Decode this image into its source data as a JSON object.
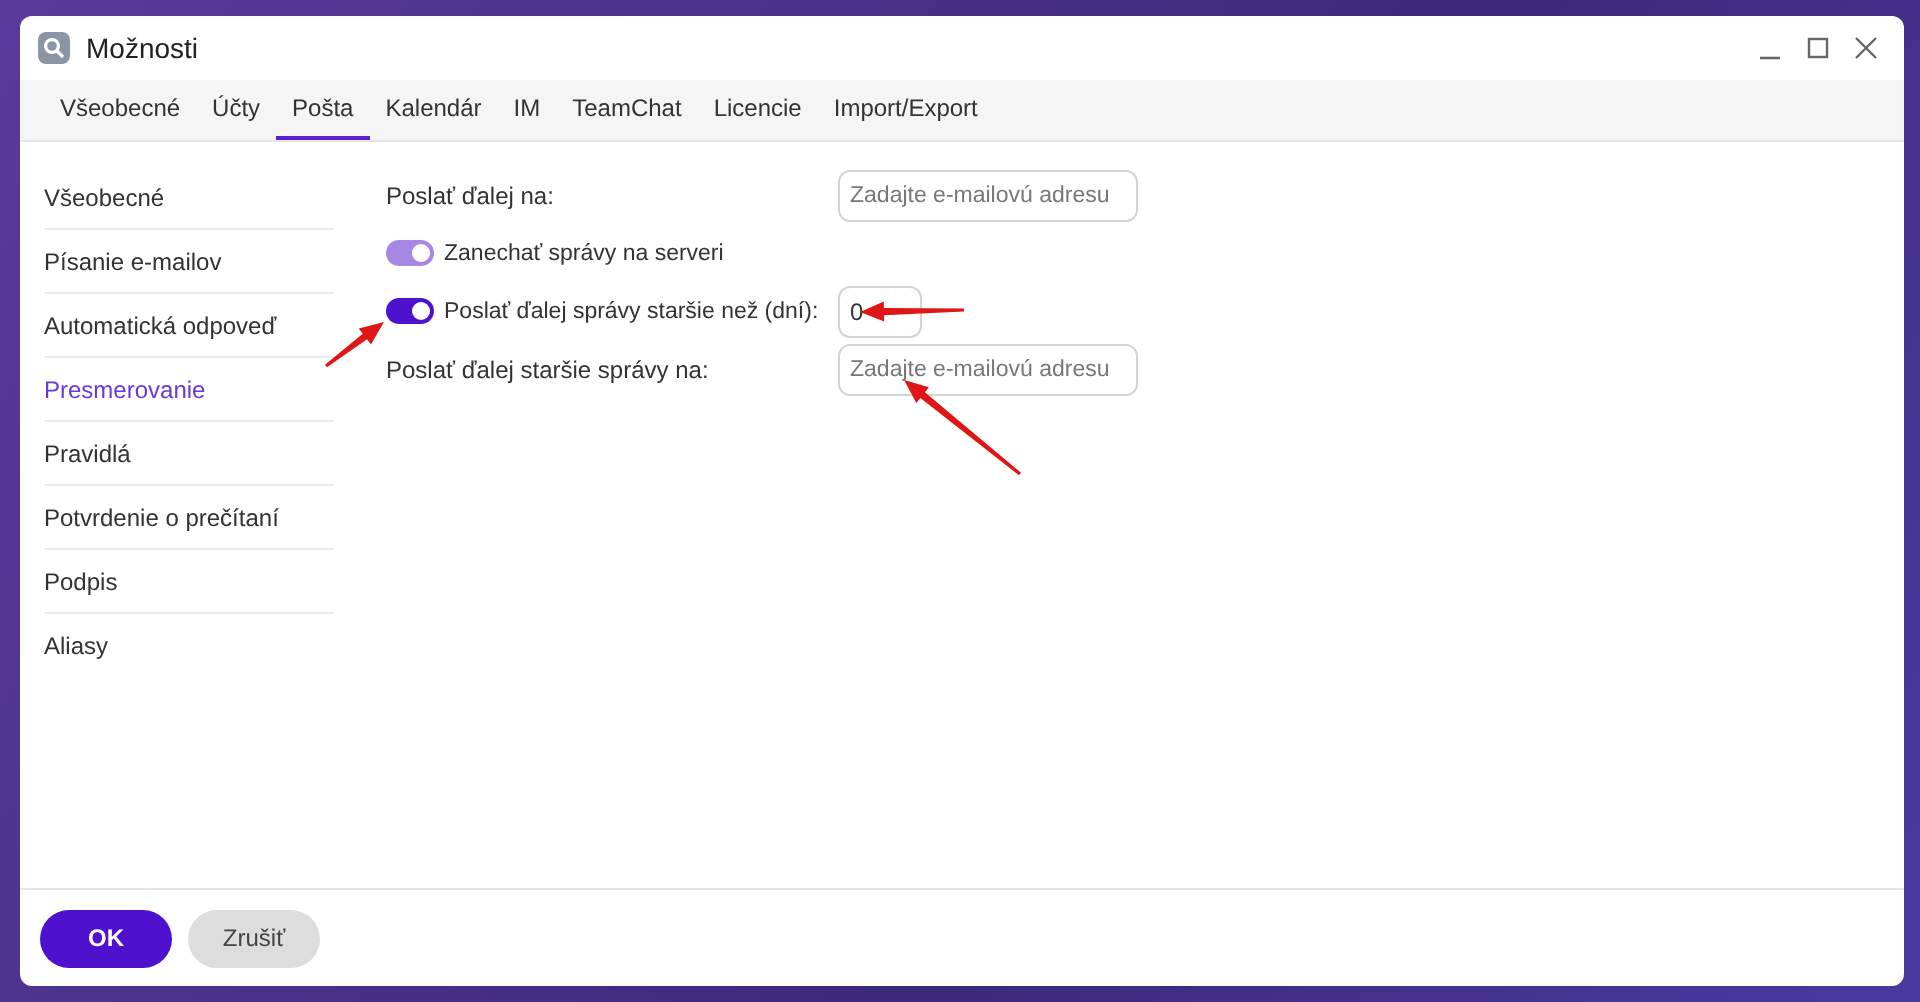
{
  "window": {
    "title": "Možnosti"
  },
  "tabs": [
    {
      "label": "Všeobecné",
      "selected": false
    },
    {
      "label": "Účty",
      "selected": false
    },
    {
      "label": "Pošta",
      "selected": true
    },
    {
      "label": "Kalendár",
      "selected": false
    },
    {
      "label": "IM",
      "selected": false
    },
    {
      "label": "TeamChat",
      "selected": false
    },
    {
      "label": "Licencie",
      "selected": false
    },
    {
      "label": "Import/Export",
      "selected": false
    }
  ],
  "sidebar": {
    "items": [
      {
        "label": "Všeobecné",
        "selected": false
      },
      {
        "label": "Písanie e-mailov",
        "selected": false
      },
      {
        "label": "Automatická odpoveď",
        "selected": false
      },
      {
        "label": "Presmerovanie",
        "selected": true
      },
      {
        "label": "Pravidlá",
        "selected": false
      },
      {
        "label": "Potvrdenie o prečítaní",
        "selected": false
      },
      {
        "label": "Podpis",
        "selected": false
      },
      {
        "label": "Aliasy",
        "selected": false
      }
    ]
  },
  "form": [
    {
      "kind": "field",
      "label": "Poslať ďalej na:",
      "placeholder": "Zadajte e-mailovú adresu"
    },
    {
      "kind": "toggle",
      "label": "Zanechať správy na serveri",
      "on": true,
      "disabled": true
    },
    {
      "kind": "toggle-number",
      "label": "Poslať ďalej správy staršie než (dní):",
      "on": true,
      "disabled": false,
      "value": "0"
    },
    {
      "kind": "field",
      "label": "Poslať ďalej staršie správy na:",
      "placeholder": "Zadajte e-mailovú adresu"
    }
  ],
  "buttons": [
    {
      "label": "OK",
      "kind": "primary"
    },
    {
      "label": "Zrušiť",
      "kind": "secondary"
    }
  ]
}
